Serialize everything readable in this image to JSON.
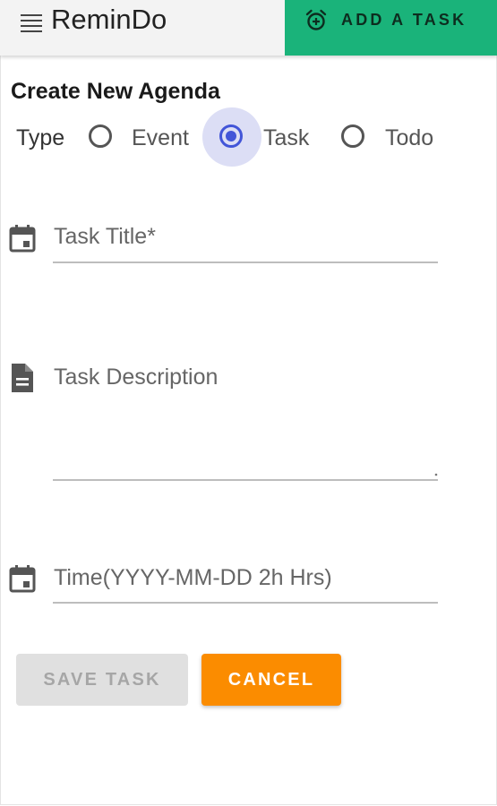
{
  "app": {
    "title": "ReminDo"
  },
  "header": {
    "add_task_label": "ADD A TASK",
    "accent_color": "#1ab37a"
  },
  "form": {
    "title": "Create New Agenda",
    "type_label": "Type",
    "type_options": [
      {
        "label": "Event",
        "selected": false
      },
      {
        "label": "Task",
        "selected": true
      },
      {
        "label": "Todo",
        "selected": false
      }
    ],
    "fields": {
      "title": {
        "placeholder": "Task Title*",
        "value": ""
      },
      "description": {
        "placeholder": "Task Description",
        "value": ""
      },
      "time": {
        "placeholder": "Time(YYYY-MM-DD 2h Hrs)",
        "value": ""
      }
    },
    "buttons": {
      "save_label": "SAVE TASK",
      "cancel_label": "CANCEL"
    }
  },
  "colors": {
    "radio_selected": "#4255d8",
    "cancel": "#fb8c00",
    "save_disabled_bg": "#e0e0e0"
  }
}
